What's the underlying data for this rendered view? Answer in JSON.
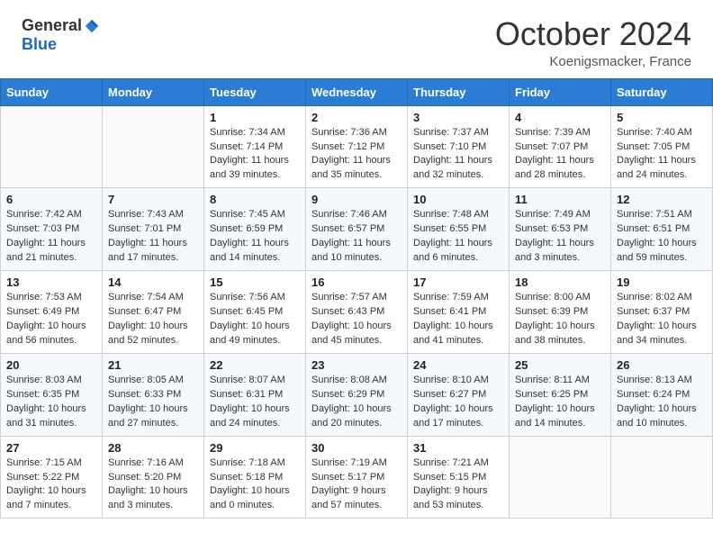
{
  "header": {
    "logo_general": "General",
    "logo_blue": "Blue",
    "month_title": "October 2024",
    "location": "Koenigsmacker, France"
  },
  "days_of_week": [
    "Sunday",
    "Monday",
    "Tuesday",
    "Wednesday",
    "Thursday",
    "Friday",
    "Saturday"
  ],
  "weeks": [
    [
      {
        "day": "",
        "info": ""
      },
      {
        "day": "",
        "info": ""
      },
      {
        "day": "1",
        "info": "Sunrise: 7:34 AM\nSunset: 7:14 PM\nDaylight: 11 hours and 39 minutes."
      },
      {
        "day": "2",
        "info": "Sunrise: 7:36 AM\nSunset: 7:12 PM\nDaylight: 11 hours and 35 minutes."
      },
      {
        "day": "3",
        "info": "Sunrise: 7:37 AM\nSunset: 7:10 PM\nDaylight: 11 hours and 32 minutes."
      },
      {
        "day": "4",
        "info": "Sunrise: 7:39 AM\nSunset: 7:07 PM\nDaylight: 11 hours and 28 minutes."
      },
      {
        "day": "5",
        "info": "Sunrise: 7:40 AM\nSunset: 7:05 PM\nDaylight: 11 hours and 24 minutes."
      }
    ],
    [
      {
        "day": "6",
        "info": "Sunrise: 7:42 AM\nSunset: 7:03 PM\nDaylight: 11 hours and 21 minutes."
      },
      {
        "day": "7",
        "info": "Sunrise: 7:43 AM\nSunset: 7:01 PM\nDaylight: 11 hours and 17 minutes."
      },
      {
        "day": "8",
        "info": "Sunrise: 7:45 AM\nSunset: 6:59 PM\nDaylight: 11 hours and 14 minutes."
      },
      {
        "day": "9",
        "info": "Sunrise: 7:46 AM\nSunset: 6:57 PM\nDaylight: 11 hours and 10 minutes."
      },
      {
        "day": "10",
        "info": "Sunrise: 7:48 AM\nSunset: 6:55 PM\nDaylight: 11 hours and 6 minutes."
      },
      {
        "day": "11",
        "info": "Sunrise: 7:49 AM\nSunset: 6:53 PM\nDaylight: 11 hours and 3 minutes."
      },
      {
        "day": "12",
        "info": "Sunrise: 7:51 AM\nSunset: 6:51 PM\nDaylight: 10 hours and 59 minutes."
      }
    ],
    [
      {
        "day": "13",
        "info": "Sunrise: 7:53 AM\nSunset: 6:49 PM\nDaylight: 10 hours and 56 minutes."
      },
      {
        "day": "14",
        "info": "Sunrise: 7:54 AM\nSunset: 6:47 PM\nDaylight: 10 hours and 52 minutes."
      },
      {
        "day": "15",
        "info": "Sunrise: 7:56 AM\nSunset: 6:45 PM\nDaylight: 10 hours and 49 minutes."
      },
      {
        "day": "16",
        "info": "Sunrise: 7:57 AM\nSunset: 6:43 PM\nDaylight: 10 hours and 45 minutes."
      },
      {
        "day": "17",
        "info": "Sunrise: 7:59 AM\nSunset: 6:41 PM\nDaylight: 10 hours and 41 minutes."
      },
      {
        "day": "18",
        "info": "Sunrise: 8:00 AM\nSunset: 6:39 PM\nDaylight: 10 hours and 38 minutes."
      },
      {
        "day": "19",
        "info": "Sunrise: 8:02 AM\nSunset: 6:37 PM\nDaylight: 10 hours and 34 minutes."
      }
    ],
    [
      {
        "day": "20",
        "info": "Sunrise: 8:03 AM\nSunset: 6:35 PM\nDaylight: 10 hours and 31 minutes."
      },
      {
        "day": "21",
        "info": "Sunrise: 8:05 AM\nSunset: 6:33 PM\nDaylight: 10 hours and 27 minutes."
      },
      {
        "day": "22",
        "info": "Sunrise: 8:07 AM\nSunset: 6:31 PM\nDaylight: 10 hours and 24 minutes."
      },
      {
        "day": "23",
        "info": "Sunrise: 8:08 AM\nSunset: 6:29 PM\nDaylight: 10 hours and 20 minutes."
      },
      {
        "day": "24",
        "info": "Sunrise: 8:10 AM\nSunset: 6:27 PM\nDaylight: 10 hours and 17 minutes."
      },
      {
        "day": "25",
        "info": "Sunrise: 8:11 AM\nSunset: 6:25 PM\nDaylight: 10 hours and 14 minutes."
      },
      {
        "day": "26",
        "info": "Sunrise: 8:13 AM\nSunset: 6:24 PM\nDaylight: 10 hours and 10 minutes."
      }
    ],
    [
      {
        "day": "27",
        "info": "Sunrise: 7:15 AM\nSunset: 5:22 PM\nDaylight: 10 hours and 7 minutes."
      },
      {
        "day": "28",
        "info": "Sunrise: 7:16 AM\nSunset: 5:20 PM\nDaylight: 10 hours and 3 minutes."
      },
      {
        "day": "29",
        "info": "Sunrise: 7:18 AM\nSunset: 5:18 PM\nDaylight: 10 hours and 0 minutes."
      },
      {
        "day": "30",
        "info": "Sunrise: 7:19 AM\nSunset: 5:17 PM\nDaylight: 9 hours and 57 minutes."
      },
      {
        "day": "31",
        "info": "Sunrise: 7:21 AM\nSunset: 5:15 PM\nDaylight: 9 hours and 53 minutes."
      },
      {
        "day": "",
        "info": ""
      },
      {
        "day": "",
        "info": ""
      }
    ]
  ]
}
